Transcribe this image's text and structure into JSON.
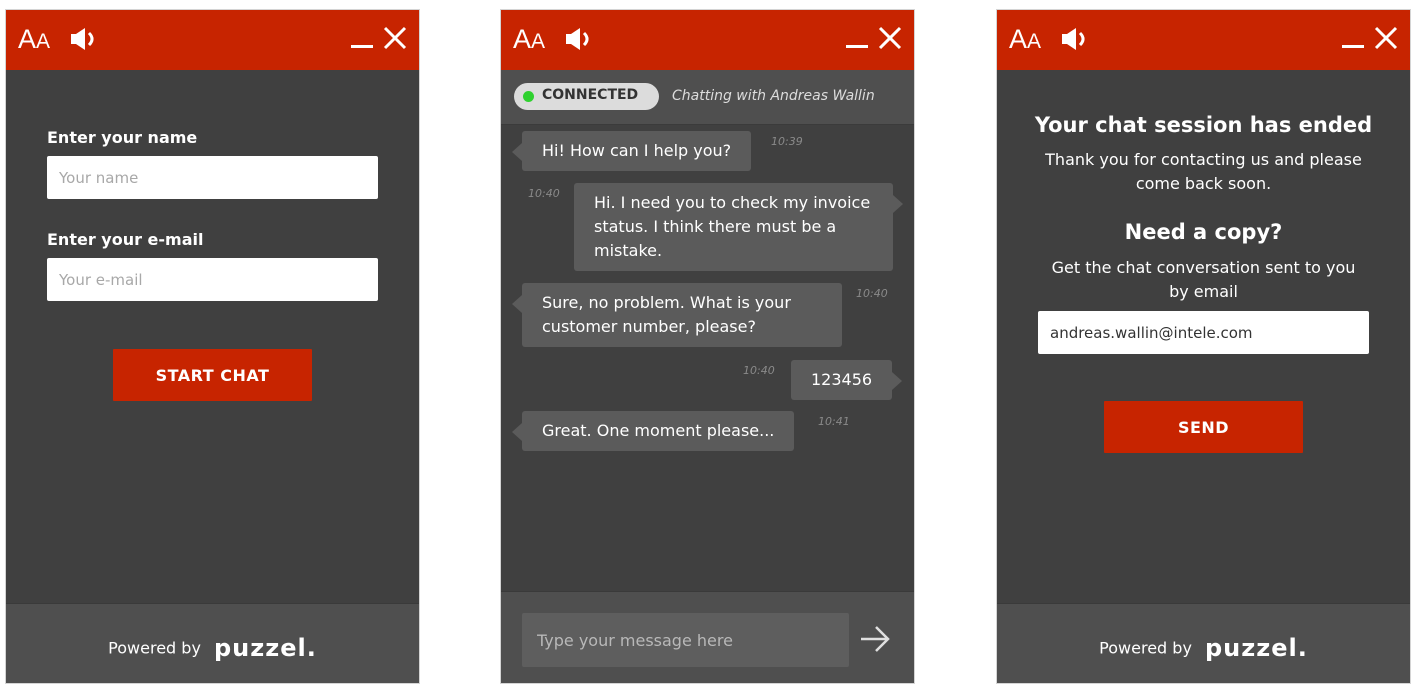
{
  "colors": {
    "brand": "#c72400",
    "panel": "#404040",
    "footer": "#4f4f4f",
    "bubble": "#5b5b5b",
    "connected": "#2fd12f"
  },
  "header": {
    "font_icon_big": "A",
    "font_icon_small": "A",
    "icons": [
      "font-size-icon",
      "speaker-icon",
      "minimize-icon",
      "close-icon"
    ]
  },
  "start_form": {
    "name_label": "Enter your name",
    "name_placeholder": "Your name",
    "email_label": "Enter your e-mail",
    "email_placeholder": "Your e-mail",
    "start_button": "START CHAT"
  },
  "footer": {
    "powered_by": "Powered by",
    "brand": "puzzel."
  },
  "chat": {
    "status": "CONNECTED",
    "chatting_with": "Chatting with Andreas Wallin",
    "messages": [
      {
        "from": "agent",
        "text": "Hi! How can I help you?",
        "time": "10:39"
      },
      {
        "from": "user",
        "text": "Hi. I need you to check my invoice status. I think there must be a mistake.",
        "time": "10:40"
      },
      {
        "from": "agent",
        "text": "Sure, no problem. What is your customer number, please?",
        "time": "10:40"
      },
      {
        "from": "user",
        "text": "123456",
        "time": "10:40"
      },
      {
        "from": "agent",
        "text": "Great. One moment please...",
        "time": "10:41"
      }
    ],
    "input_placeholder": "Type your message here"
  },
  "ended": {
    "title": "Your chat session has ended",
    "thanks": "Thank you for contacting us and please come back soon.",
    "copy_title": "Need a copy?",
    "copy_text": "Get the chat conversation sent to you by email",
    "email_value": "andreas.wallin@intele.com",
    "send_button": "SEND"
  }
}
